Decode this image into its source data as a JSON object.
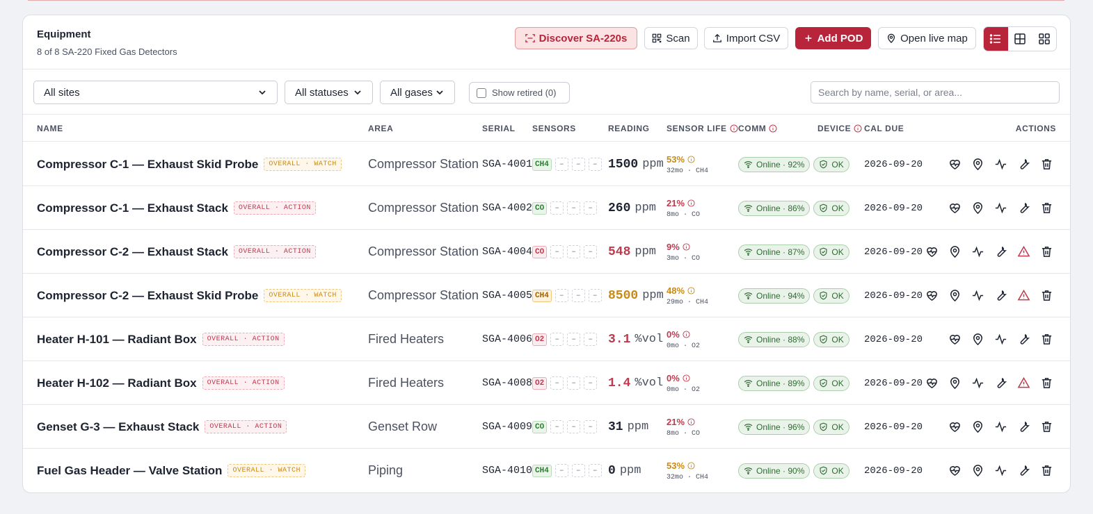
{
  "header": {
    "title": "Equipment",
    "subtitle": "8 of 8 SA-220 Fixed Gas Detectors",
    "buttons": {
      "discover": "Discover SA-220s",
      "scan": "Scan",
      "import": "Import CSV",
      "add": "Add POD",
      "map": "Open live map"
    }
  },
  "filters": {
    "site": "All sites",
    "status": "All statuses",
    "gas": "All gases",
    "retired": "Show retired (0)",
    "search_placeholder": "Search by name, serial, or area..."
  },
  "columns": {
    "name": "NAME",
    "area": "AREA",
    "serial": "SERIAL",
    "sensors": "SENSORS",
    "reading": "READING",
    "life": "SENSOR LIFE",
    "comm": "COMM",
    "device": "DEVICE",
    "cal": "CAL DUE",
    "actions": "ACTIONS"
  },
  "colors": {
    "accent": "#b8243a",
    "ok": "#2e7d32",
    "warn": "#c98a15",
    "bad": "#c0394d"
  },
  "rows": [
    {
      "name": "Compressor C-1 — Exhaust Skid Probe",
      "badge": "OVERALL · WATCH",
      "badge_type": "watch",
      "area": "Compressor Station",
      "serial": "SGA-4001",
      "sensor": "CH4",
      "sensor_state": "ok",
      "value": "1500",
      "unit": "ppm",
      "value_color": "#1d2330",
      "life_pct": "53%",
      "life_color": "#c98a15",
      "life_detail": "32mo · CH4",
      "comm": "Online · 92%",
      "device": "OK",
      "cal": "2026-09-20",
      "alert": false
    },
    {
      "name": "Compressor C-1 — Exhaust Stack",
      "badge": "OVERALL · ACTION",
      "badge_type": "action",
      "area": "Compressor Station",
      "serial": "SGA-4002",
      "sensor": "CO",
      "sensor_state": "ok",
      "value": "260",
      "unit": "ppm",
      "value_color": "#1d2330",
      "life_pct": "21%",
      "life_color": "#c0394d",
      "life_detail": "8mo · CO",
      "comm": "Online · 86%",
      "device": "OK",
      "cal": "2026-09-20",
      "alert": false
    },
    {
      "name": "Compressor C-2 — Exhaust Stack",
      "badge": "OVERALL · ACTION",
      "badge_type": "action",
      "area": "Compressor Station",
      "serial": "SGA-4004",
      "sensor": "CO",
      "sensor_state": "bad",
      "value": "548",
      "unit": "ppm",
      "value_color": "#c0394d",
      "life_pct": "9%",
      "life_color": "#c0394d",
      "life_detail": "3mo · CO",
      "comm": "Online · 87%",
      "device": "OK",
      "cal": "2026-09-20",
      "alert": true
    },
    {
      "name": "Compressor C-2 — Exhaust Skid Probe",
      "badge": "OVERALL · WATCH",
      "badge_type": "watch",
      "area": "Compressor Station",
      "serial": "SGA-4005",
      "sensor": "CH4",
      "sensor_state": "warn",
      "value": "8500",
      "unit": "ppm",
      "value_color": "#c98a15",
      "life_pct": "48%",
      "life_color": "#c98a15",
      "life_detail": "29mo · CH4",
      "comm": "Online · 94%",
      "device": "OK",
      "cal": "2026-09-20",
      "alert": true
    },
    {
      "name": "Heater H-101 — Radiant Box",
      "badge": "OVERALL · ACTION",
      "badge_type": "action",
      "area": "Fired Heaters",
      "serial": "SGA-4006",
      "sensor": "O2",
      "sensor_state": "bad",
      "value": "3.1",
      "unit": "%vol",
      "value_color": "#c0394d",
      "life_pct": "0%",
      "life_color": "#c0394d",
      "life_detail": "0mo · O2",
      "comm": "Online · 88%",
      "device": "OK",
      "cal": "2026-09-20",
      "alert": false
    },
    {
      "name": "Heater H-102 — Radiant Box",
      "badge": "OVERALL · ACTION",
      "badge_type": "action",
      "area": "Fired Heaters",
      "serial": "SGA-4008",
      "sensor": "O2",
      "sensor_state": "bad",
      "value": "1.4",
      "unit": "%vol",
      "value_color": "#c0394d",
      "life_pct": "0%",
      "life_color": "#c0394d",
      "life_detail": "0mo · O2",
      "comm": "Online · 89%",
      "device": "OK",
      "cal": "2026-09-20",
      "alert": true
    },
    {
      "name": "Genset G-3 — Exhaust Stack",
      "badge": "OVERALL · ACTION",
      "badge_type": "action",
      "area": "Genset Row",
      "serial": "SGA-4009",
      "sensor": "CO",
      "sensor_state": "ok",
      "value": "31",
      "unit": "ppm",
      "value_color": "#1d2330",
      "life_pct": "21%",
      "life_color": "#c0394d",
      "life_detail": "8mo · CO",
      "comm": "Online · 96%",
      "device": "OK",
      "cal": "2026-09-20",
      "alert": false
    },
    {
      "name": "Fuel Gas Header — Valve Station",
      "badge": "OVERALL · WATCH",
      "badge_type": "watch",
      "area": "Piping",
      "serial": "SGA-4010",
      "sensor": "CH4",
      "sensor_state": "ok",
      "value": "0",
      "unit": "ppm",
      "value_color": "#1d2330",
      "life_pct": "53%",
      "life_color": "#c98a15",
      "life_detail": "32mo · CH4",
      "comm": "Online · 90%",
      "device": "OK",
      "cal": "2026-09-20",
      "alert": false
    }
  ]
}
